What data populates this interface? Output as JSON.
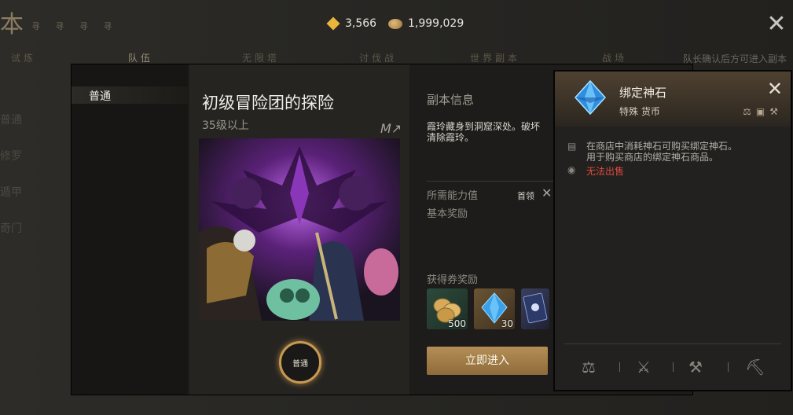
{
  "currency": {
    "gem_amount": "3,566",
    "coin_amount": "1,999,029"
  },
  "tabs": [
    {
      "label": "试炼"
    },
    {
      "label": "队伍"
    },
    {
      "label": "无限塔"
    },
    {
      "label": "讨伐战"
    },
    {
      "label": "世界副本"
    },
    {
      "label": "战场"
    }
  ],
  "tab_note": "队长确认后方可进入副本",
  "side_menu": [
    "普通",
    "修罗",
    "遁甲",
    "奇门"
  ],
  "difficulty": {
    "selected": "普通"
  },
  "dungeon": {
    "title": "初级冒险团的探险",
    "level_req": "35级以上",
    "mode_label": "普通"
  },
  "info": {
    "section_title": "副本信息",
    "description_line1": "霞玲藏身到洞窟深处。破坏",
    "description_line2": "清除霞玲。",
    "required_power_label": "所需能力值",
    "first_kill_label": "首领",
    "base_reward_label": "基本奖励",
    "ticket_reward_label": "获得券奖励",
    "rewards": [
      {
        "icon": "coin-pile-icon",
        "qty": "500"
      },
      {
        "icon": "blue-crystal-icon",
        "qty": "30"
      },
      {
        "icon": "card-icon",
        "qty": ""
      }
    ],
    "enter_button": "立即进入"
  },
  "tooltip": {
    "item_name": "绑定神石",
    "category": "特殊 货币",
    "desc_line1": "在商店中消耗神石可购买绑定神石。",
    "desc_line2": "用于购买商店的绑定神石商品。",
    "warning": "无法出售"
  },
  "colors": {
    "accent_gold": "#b48e55",
    "warning_red": "#e04b3d",
    "crystal_blue": "#3aa0e8"
  }
}
